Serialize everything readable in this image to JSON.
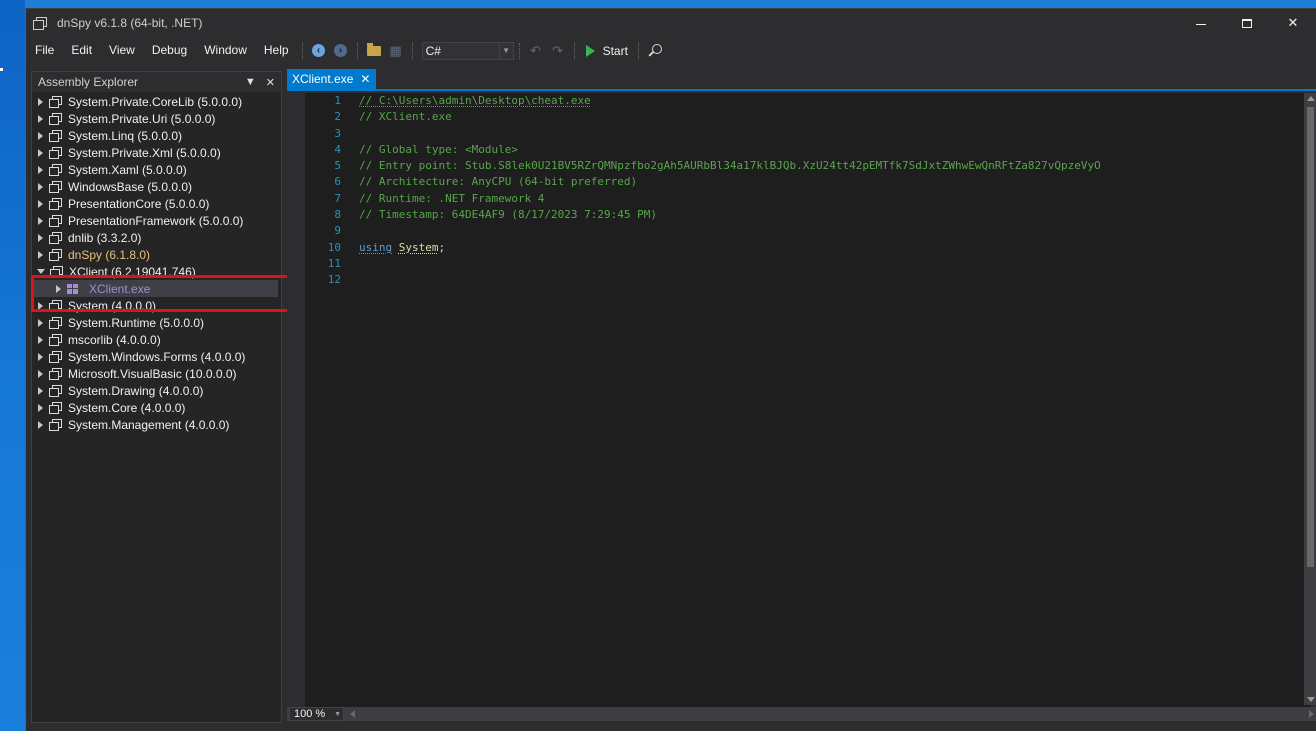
{
  "window": {
    "title": "dnSpy v6.1.8 (64-bit, .NET)",
    "controls": {
      "minimize": "—",
      "maximize": "□",
      "close": "✕"
    }
  },
  "menu": [
    "File",
    "Edit",
    "View",
    "Debug",
    "Window",
    "Help"
  ],
  "toolbar": {
    "language": "C#",
    "start_label": "Start"
  },
  "explorer": {
    "title": "Assembly Explorer",
    "items": [
      {
        "label": "System.Private.CoreLib (5.0.0.0)"
      },
      {
        "label": "System.Private.Uri (5.0.0.0)"
      },
      {
        "label": "System.Linq (5.0.0.0)"
      },
      {
        "label": "System.Private.Xml (5.0.0.0)"
      },
      {
        "label": "System.Xaml (5.0.0.0)"
      },
      {
        "label": "WindowsBase (5.0.0.0)"
      },
      {
        "label": "PresentationCore (5.0.0.0)"
      },
      {
        "label": "PresentationFramework (5.0.0.0)"
      },
      {
        "label": "dnlib (3.3.2.0)"
      },
      {
        "label": "dnSpy (6.1.8.0)"
      },
      {
        "label": "XClient (6.2.19041.746)"
      },
      {
        "label": "XClient.exe"
      },
      {
        "label": "System (4.0.0.0)"
      },
      {
        "label": "System.Runtime (5.0.0.0)"
      },
      {
        "label": "mscorlib (4.0.0.0)"
      },
      {
        "label": "System.Windows.Forms (4.0.0.0)"
      },
      {
        "label": "Microsoft.VisualBasic (10.0.0.0)"
      },
      {
        "label": "System.Drawing (4.0.0.0)"
      },
      {
        "label": "System.Core (4.0.0.0)"
      },
      {
        "label": "System.Management (4.0.0.0)"
      }
    ]
  },
  "editor": {
    "tab_label": "XClient.exe",
    "lines": [
      {
        "n": "1",
        "text": "// C:\\Users\\admin\\Desktop\\cheat.exe"
      },
      {
        "n": "2",
        "text": "// XClient.exe"
      },
      {
        "n": "3",
        "text": ""
      },
      {
        "n": "4",
        "text": "// Global type: <Module>"
      },
      {
        "n": "5",
        "text": "// Entry point: Stub.S8lek0U21BV5RZrQMNpzfbo2gAh5AURbBl34a17klBJQb.XzU24tt42pEMTfk7SdJxtZWhwEwQnRFtZa827vQpzeVyO"
      },
      {
        "n": "6",
        "text": "// Architecture: AnyCPU (64-bit preferred)"
      },
      {
        "n": "7",
        "text": "// Runtime: .NET Framework 4"
      },
      {
        "n": "8",
        "text": "// Timestamp: 64DE4AF9 (8/17/2023 7:29:45 PM)"
      },
      {
        "n": "9",
        "text": ""
      },
      {
        "n": "10",
        "using": "using",
        "ns": "System",
        "semi": ";"
      },
      {
        "n": "11",
        "text": ""
      },
      {
        "n": "12",
        "text": ""
      }
    ],
    "zoom": "100 %"
  },
  "colors": {
    "accent": "#007acc",
    "comment": "#57a64a",
    "keyword": "#569cd6",
    "highlight_box": "#e0111b"
  }
}
